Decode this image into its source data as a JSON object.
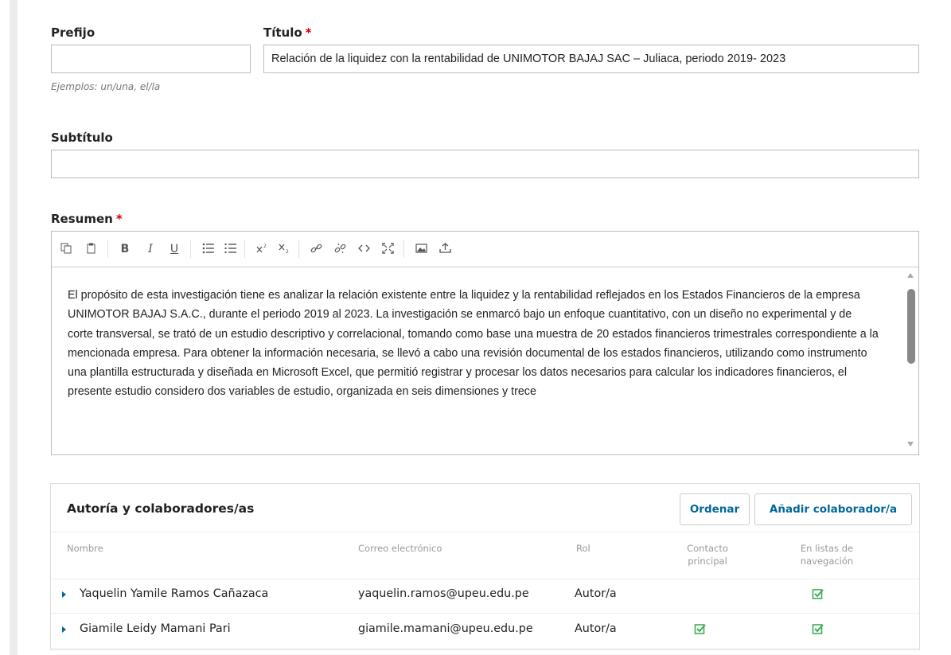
{
  "prefix": {
    "label": "Prefijo",
    "value": "",
    "hint": "Ejemplos: un/una, el/la"
  },
  "title": {
    "label": "Título",
    "required_mark": "*",
    "value": "Relación de la liquidez con la rentabilidad de UNIMOTOR BAJAJ SAC – Juliaca, periodo 2019- 2023"
  },
  "subtitle": {
    "label": "Subtítulo",
    "value": ""
  },
  "abstract": {
    "label": "Resumen",
    "required_mark": "*",
    "toolbar": [
      "copy-icon",
      "paste-icon",
      "bold-icon",
      "italic-icon",
      "underline-icon",
      "bullet-list-icon",
      "numbered-list-icon",
      "superscript-icon",
      "subscript-icon",
      "link-icon",
      "unlink-icon",
      "code-icon",
      "fullscreen-icon",
      "image-icon",
      "upload-icon"
    ],
    "toolbar_glyphs": {
      "bold": "B",
      "italic": "I",
      "underline": "U"
    },
    "text": "El propósito de esta investigación tiene es analizar la relación existente entre la liquidez y la rentabilidad reflejados en los Estados Financieros de la empresa UNIMOTOR BAJAJ S.A.C., durante el periodo 2019 al 2023. La investigación se enmarcó bajo un enfoque cuantitativo, con un diseño no experimental y de corte transversal, se trató de un estudio descriptivo y correlacional, tomando como base una muestra de 20 estados financieros trimestrales correspondiente a la mencionada empresa. Para obtener la información necesaria, se llevó a cabo una revisión documental de los estados financieros, utilizando como instrumento una plantilla estructurada y diseñada en Microsoft Excel, que permitió registrar y procesar los datos necesarios para calcular los indicadores financieros, el presente estudio considero dos variables de estudio, organizada en seis dimensiones y trece"
  },
  "contributors": {
    "title": "Autoría y colaboradores/as",
    "order_button": "Ordenar",
    "add_button": "Añadir colaborador/a",
    "columns": {
      "name": "Nombre",
      "email": "Correo electrónico",
      "role": "Rol",
      "primary_contact": [
        "Contacto",
        "principal"
      ],
      "in_browse": [
        "En listas de",
        "navegación"
      ]
    },
    "rows": [
      {
        "name": "Yaquelin Yamile Ramos Cañazaca",
        "email": "yaquelin.ramos@upeu.edu.pe",
        "role": "Autor/a",
        "primary_contact": false,
        "in_browse": true
      },
      {
        "name": "Giamile Leidy Mamani Pari",
        "email": "giamile.mamani@upeu.edu.pe",
        "role": "Autor/a",
        "primary_contact": true,
        "in_browse": true
      }
    ]
  },
  "colors": {
    "accent": "#006798",
    "required": "#d00000",
    "check": "#3cae55"
  }
}
